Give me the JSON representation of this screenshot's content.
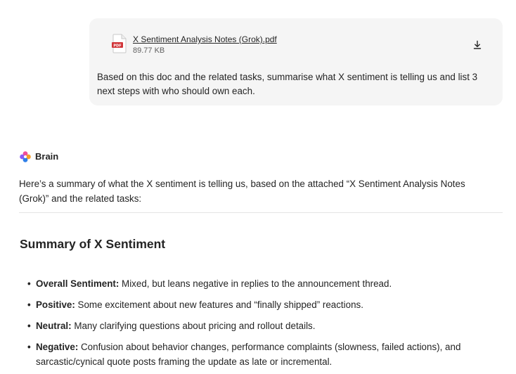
{
  "user_message": {
    "attachment": {
      "file_name": "X Sentiment Analysis Notes (Grok).pdf",
      "file_size": "89.77 KB",
      "file_type_label": "PDF",
      "icon": "pdf-file-icon",
      "download_icon": "download-icon"
    },
    "text": "Based on this doc and the related tasks, summarise what X sentiment is telling us and list 3 next steps with who should own each."
  },
  "assistant": {
    "name": "Brain",
    "icon": "brain-logo-icon",
    "intro": "Here’s a summary of what the X sentiment is telling us, based on the attached “X Sentiment Analysis Notes (Grok)” and the related tasks:",
    "section_title": "Summary of X Sentiment",
    "bullets": [
      {
        "term": "Overall Sentiment:",
        "text": " Mixed, but leans negative in replies to the announcement thread."
      },
      {
        "term": "Positive:",
        "text": " Some excitement about new features and “finally shipped” reactions."
      },
      {
        "term": "Neutral:",
        "text": " Many clarifying questions about pricing and rollout details."
      },
      {
        "term": "Negative:",
        "text": " Confusion about behavior changes, performance complaints (slowness, failed actions), and sarcastic/cynical quote posts framing the update as late or incremental."
      }
    ]
  },
  "colors": {
    "bubble_bg": "#f5f5f5",
    "pdf_red": "#d13438",
    "text": "#242424",
    "muted": "#616161",
    "divider": "#e4e4e4"
  }
}
